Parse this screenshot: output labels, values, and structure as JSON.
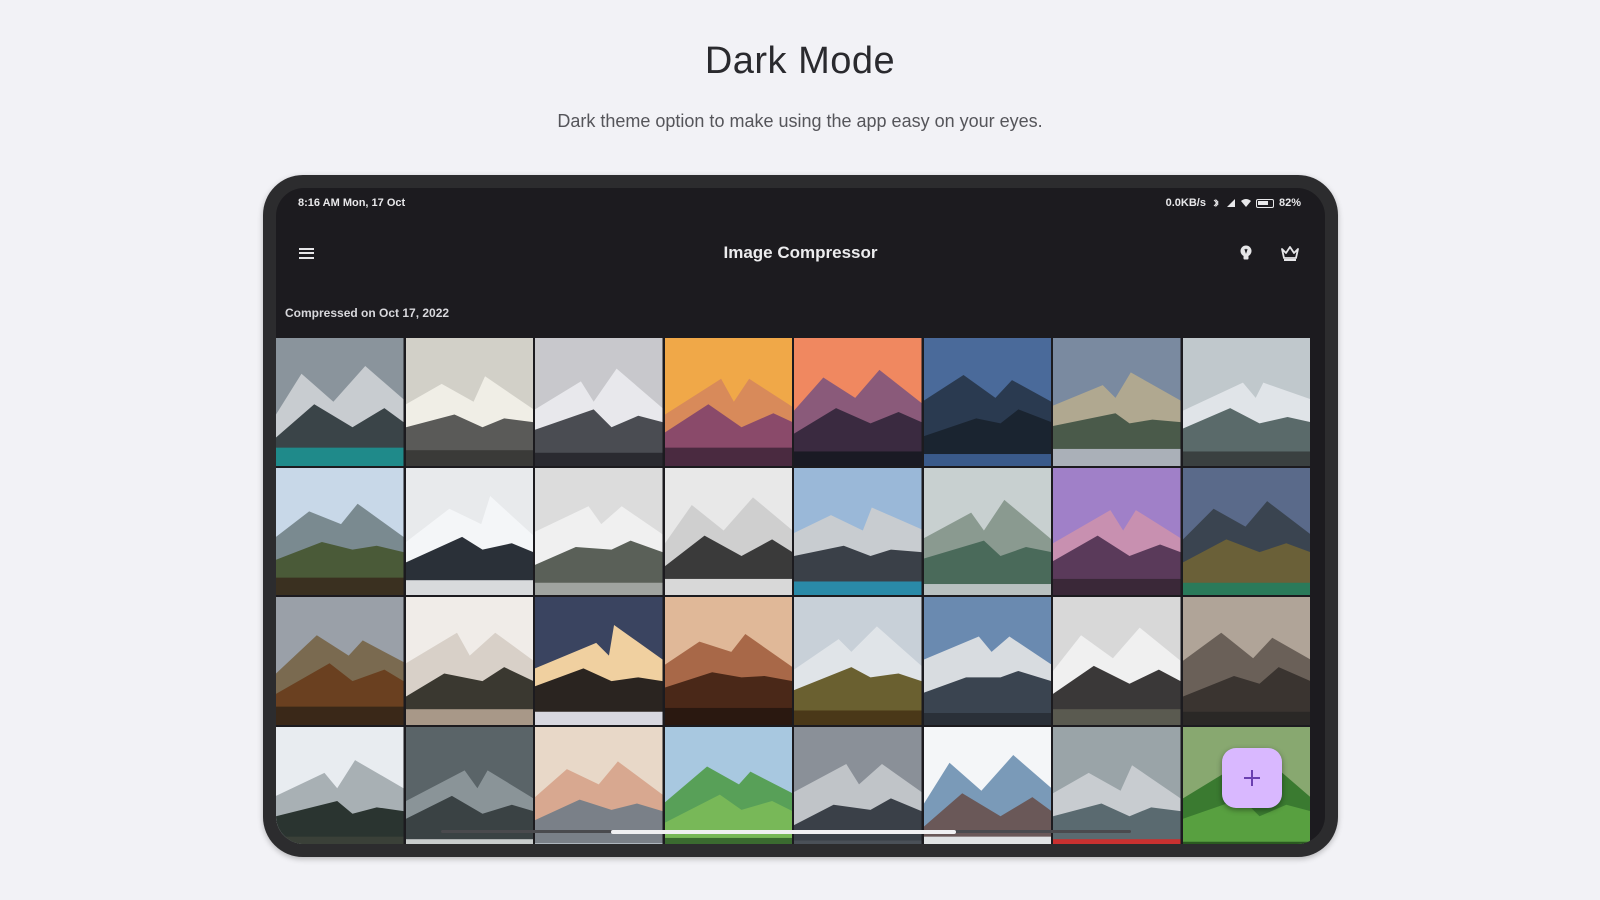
{
  "heading": "Dark Mode",
  "subheading": "Dark theme option to make using the app easy on your eyes.",
  "status_bar": {
    "time": "8:16 AM  Mon, 17 Oct",
    "speed": "0.0KB/s",
    "battery": "82%"
  },
  "app_bar": {
    "title": "Image Compressor",
    "menu_icon": "hamburger-menu-icon",
    "bulb_icon": "lightbulb-icon",
    "crown_icon": "crown-icon"
  },
  "section_label": "Compressed on Oct 17, 2022",
  "fab_icon": "plus-icon",
  "colors": {
    "background": "#f2f2f6",
    "screen": "#1c1b1f",
    "fab": "#d9b8ff"
  },
  "thumbnails": [
    {
      "sky": "#8a949c",
      "far": "#c8ccd0",
      "near": "#3a4448",
      "ground": "#1f8a8a"
    },
    {
      "sky": "#d2d0c8",
      "far": "#f0eee6",
      "near": "#5a5a58",
      "ground": "#3a3a38"
    },
    {
      "sky": "#c8c8cc",
      "far": "#e8e8ec",
      "near": "#4a4c52",
      "ground": "#2a2a30"
    },
    {
      "sky": "#f0a848",
      "far": "#d88a5a",
      "near": "#8a4a6a",
      "ground": "#4a2a40"
    },
    {
      "sky": "#f08860",
      "far": "#8a5a7a",
      "near": "#3a2a40",
      "ground": "#1a1a24"
    },
    {
      "sky": "#4a6a9a",
      "far": "#2a3a50",
      "near": "#1a2430",
      "ground": "#3a5a8a"
    },
    {
      "sky": "#7a8aa0",
      "far": "#b0a890",
      "near": "#4a5a4a",
      "ground": "#aab0b8"
    },
    {
      "sky": "#c0c8cc",
      "far": "#e0e4e8",
      "near": "#5a6a6a",
      "ground": "#3a4040"
    },
    {
      "sky": "#c8d8e8",
      "far": "#7a8a90",
      "near": "#4a5a38",
      "ground": "#3a3020"
    },
    {
      "sky": "#e8eaec",
      "far": "#f4f6f8",
      "near": "#2a3038",
      "ground": "#d8dadc"
    },
    {
      "sky": "#dcdcdc",
      "far": "#f0f0f0",
      "near": "#5a6058",
      "ground": "#a0a4a0"
    },
    {
      "sky": "#e8e8e8",
      "far": "#cfcfcf",
      "near": "#3a3a3a",
      "ground": "#d8d8d8"
    },
    {
      "sky": "#9ab8d8",
      "far": "#c8ccd0",
      "near": "#3a4048",
      "ground": "#2a8aa8"
    },
    {
      "sky": "#c8d0d0",
      "far": "#8a9a90",
      "near": "#4a6a5a",
      "ground": "#b8c0c0"
    },
    {
      "sky": "#a080c8",
      "far": "#c890b0",
      "near": "#5a3a5a",
      "ground": "#3a2838"
    },
    {
      "sky": "#5a6a8a",
      "far": "#3a4450",
      "near": "#6a6038",
      "ground": "#2a7a5a"
    },
    {
      "sky": "#9aa0a8",
      "far": "#7a6a50",
      "near": "#6a4020",
      "ground": "#3a2818"
    },
    {
      "sky": "#f0ece8",
      "far": "#d8d0c8",
      "near": "#3a3830",
      "ground": "#a89888"
    },
    {
      "sky": "#3a4460",
      "far": "#f0d0a0",
      "near": "#2a2420",
      "ground": "#d8d8e0"
    },
    {
      "sky": "#e0b898",
      "far": "#a86848",
      "near": "#4a2818",
      "ground": "#2a1810"
    },
    {
      "sky": "#c8d0d8",
      "far": "#e0e4e8",
      "near": "#6a6030",
      "ground": "#4a3818"
    },
    {
      "sky": "#6a8ab0",
      "far": "#d8dce0",
      "near": "#3a4450",
      "ground": "#2a3038"
    },
    {
      "sky": "#d8d8d8",
      "far": "#f0f0f0",
      "near": "#3a3838",
      "ground": "#5a5a50"
    },
    {
      "sky": "#b0a498",
      "far": "#6a6058",
      "near": "#3a3430",
      "ground": "#2a2826"
    },
    {
      "sky": "#e8ecf0",
      "far": "#a8b0b4",
      "near": "#2a3430",
      "ground": "#3a4038"
    },
    {
      "sky": "#5a6468",
      "far": "#8a9498",
      "near": "#3a4244",
      "ground": "#c8cccc"
    },
    {
      "sky": "#e8d8c8",
      "far": "#d8a890",
      "near": "#7a8088",
      "ground": "#b0b8c0"
    },
    {
      "sky": "#a8c8e0",
      "far": "#58a058",
      "near": "#78b858",
      "ground": "#3a6a30"
    },
    {
      "sky": "#8a9098",
      "far": "#c0c4c8",
      "near": "#3a4048",
      "ground": "#4a5058"
    },
    {
      "sky": "#f4f6f8",
      "far": "#7a9ab8",
      "near": "#6a5858",
      "ground": "#e0e2e4"
    },
    {
      "sky": "#9aa4a8",
      "far": "#c8ccd0",
      "near": "#5a6a70",
      "ground": "#c83030"
    },
    {
      "sky": "#88a870",
      "far": "#3a7a30",
      "near": "#58a040",
      "ground": "#2a5a20"
    }
  ]
}
